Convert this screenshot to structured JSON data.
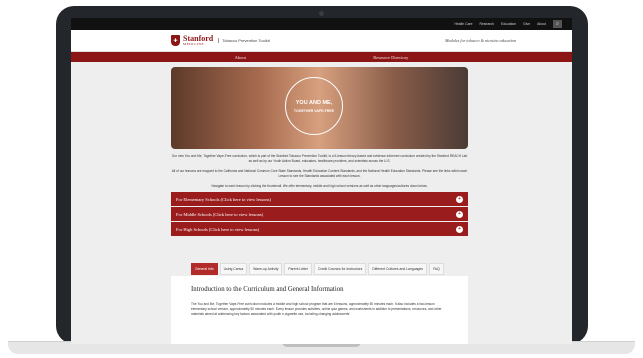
{
  "topbar": {
    "links": [
      "Health Care",
      "Research",
      "Education",
      "Give",
      "About"
    ]
  },
  "brand": {
    "name_line1": "Stanford",
    "name_line2": "MEDICINE",
    "toolkit": "Tobacco Prevention Toolkit",
    "tagline": "Modules for tobacco & nicotine education"
  },
  "nav": [
    "About",
    "Resource Directory"
  ],
  "hero": {
    "badge_title": "YOU AND ME,",
    "badge_subtitle": "TOGETHER VAPE-FREE"
  },
  "intro": {
    "p1": "Our new You and Me, Together Vape-Free curriculum, which is part of the Stanford Tobacco Prevention Toolkit, is a 6-lesson theory-based and evidence-informed curriculum created by the Stanford REACH Lab as well as by our Youth Action Board, educators, healthcare providers, and scientists across the U.S.",
    "p2": "All of our lessons are mapped to the California and National Common Core State Standards, Health Education Content Standards, and the National Health Education Standards. Please see the links within each Lesson to see the Standards associated with each lesson.",
    "p3": "Navigate to each lesson by clicking the thumbnail. We offer elementary, middle and high school versions as well as other languages/cultures down below."
  },
  "accordion": [
    {
      "label": "For Elementary Schools (Click here to view lessons)"
    },
    {
      "label": "For Middle Schools (Click here to view lessons)"
    },
    {
      "label": "For High Schools (Click here to view lessons)"
    }
  ],
  "tabs": [
    "General Info",
    "Using Canva",
    "Warm-up Activity",
    "Parent Letter",
    "Credit Courses for Instructors",
    "Different Cultures and Languages",
    "FAQ"
  ],
  "content": {
    "title": "Introduction to the Curriculum and General Information",
    "body": "The You and Me, Together Vape-Free curriculum includes a middle and high school program that are 6 lessons, approximately 50 minutes each. It also includes a two-lesson elementary school version, approximately 50 minutes each. Every lesson provides activities, online quiz games, and worksheets in addition to presentations, resources, and other materials aimed at addressing key factors associated with youth e-cigarette use, including changing adolescents'"
  }
}
